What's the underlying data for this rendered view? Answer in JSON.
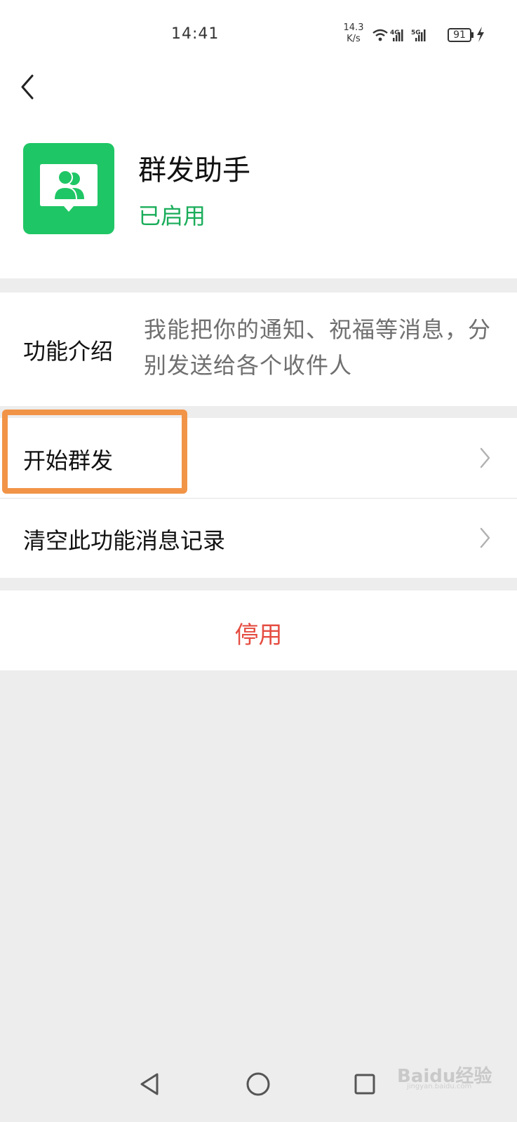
{
  "status_bar": {
    "time": "14:41",
    "net_speed_value": "14.3",
    "net_speed_unit": "K/s",
    "wifi_icon": "wifi-icon",
    "sim1_label": "4G",
    "sim2_label": "5G",
    "battery_level": "91",
    "charging_icon": "bolt-icon"
  },
  "header": {
    "back_icon": "chevron-left-icon"
  },
  "app": {
    "icon": "group-users-icon",
    "title": "群发助手",
    "status": "已启用",
    "status_color": "#1aad5a",
    "icon_color": "#1fc665"
  },
  "intro": {
    "label": "功能介绍",
    "description": "我能把你的通知、祝福等消息，分别发送给各个收件人"
  },
  "menu": {
    "items": [
      {
        "label": "开始群发",
        "icon": "chevron-right-icon",
        "highlighted": true
      },
      {
        "label": "清空此功能消息记录",
        "icon": "chevron-right-icon",
        "highlighted": false
      }
    ],
    "highlight_color": "#f29448"
  },
  "disable": {
    "label": "停用",
    "color": "#e54d42"
  },
  "nav_bar": {
    "back_icon": "triangle-back-icon",
    "home_icon": "circle-home-icon",
    "recents_icon": "square-recents-icon"
  },
  "watermark": {
    "text": "Baidu经验",
    "sub": "jingyan.baidu.com"
  }
}
